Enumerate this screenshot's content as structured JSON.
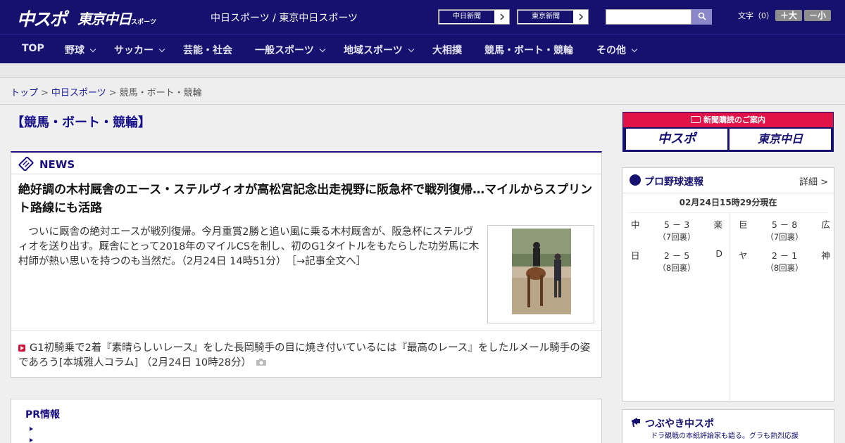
{
  "header": {
    "logo_chuspo": "中スポ",
    "logo_tokyo": "東京中日",
    "logo_tokyo_small": "スポーツ",
    "site_title": "中日スポーツ / 東京中日スポーツ",
    "paper_links": [
      "中日新聞",
      "東京新聞"
    ],
    "search_placeholder": "",
    "fontsize_label": "文字（0）",
    "fontsize_up": "＋大",
    "fontsize_down": "－小"
  },
  "nav": {
    "items": [
      "TOP",
      "野球",
      "サッカー",
      "芸能・社会",
      "一般スポーツ",
      "地域スポーツ",
      "大相撲",
      "競馬・ボート・競輪",
      "その他"
    ]
  },
  "breadcrumb": {
    "top": "トップ",
    "section": "中日スポーツ",
    "current": "競馬・ボート・競輪",
    "sep": ">"
  },
  "page": {
    "heading": "【競馬・ボート・競輪】"
  },
  "news": {
    "label": "NEWS",
    "lead_title": "絶好調の木村厩舎のエース・ステルヴィオが高松宮記念出走視野に阪急杯で戦列復帰…マイルからスプリント路線にも活路",
    "lead_body": "ついに厩舎の絶対エースが戦列復帰。今月重賞2勝と追い風に乗る木村厩舎が、阪急杯にステルヴィオを送り出す。厩舎にとって2018年のマイルCSを制し、初のG1タイトルをもたらした功労馬に木村師が熱い思いを持つのも当然だ。（2月24日 14時51分）　［→記事全文へ］",
    "sub_item": "G1初騎乗で2着『素晴らしいレース』をした長岡騎手の目に焼き付いているには『最高のレース』をしたルメール騎手の姿であろう[本城雅人コラム] （2月24日 10時28分）"
  },
  "pr": {
    "title": "PR情報"
  },
  "subscribe": {
    "head": "新聞購読のご案内",
    "chuspo": "中スポ",
    "tokyo": "東京中日"
  },
  "baseball": {
    "title": "プロ野球速報",
    "detail": "詳細 >",
    "time": "02月24日15時29分現在",
    "games": [
      {
        "home": "中",
        "score": "5 － 3",
        "away": "楽",
        "inning": "（7回裏）"
      },
      {
        "home": "巨",
        "score": "5 － 8",
        "away": "広",
        "inning": "（7回裏）"
      },
      {
        "home": "日",
        "score": "2 － 5",
        "away": "D",
        "inning": "（8回裏）"
      },
      {
        "home": "ヤ",
        "score": "2 － 1",
        "away": "神",
        "inning": "（8回裏）"
      }
    ]
  },
  "tweet": {
    "title": "つぶやき中スポ",
    "subtitle": "ドラ観戦の本紙評論家も語る。グラも熱烈応援"
  },
  "colors": {
    "brand_navy": "#16106e",
    "accent_red": "#e01247",
    "link_blue": "#1a1a9e"
  }
}
